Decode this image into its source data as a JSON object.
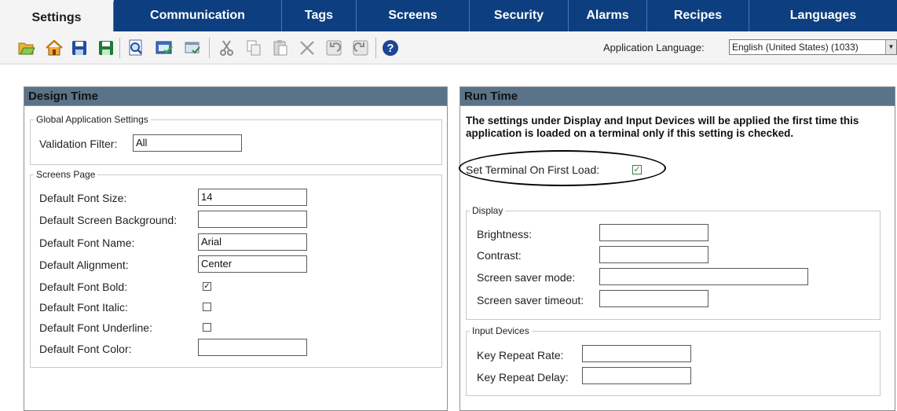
{
  "tabs": [
    {
      "label": "Settings",
      "active": true
    },
    {
      "label": "Communication",
      "active": false
    },
    {
      "label": "Tags",
      "active": false
    },
    {
      "label": "Screens",
      "active": false
    },
    {
      "label": "Security",
      "active": false
    },
    {
      "label": "Alarms",
      "active": false
    },
    {
      "label": "Recipes",
      "active": false
    },
    {
      "label": "Languages",
      "active": false
    }
  ],
  "toolbar": {
    "icons": [
      "open-icon",
      "home-icon",
      "save-icon",
      "save-as-icon",
      "find-icon",
      "validate-icon",
      "properties-icon",
      "cut-icon",
      "copy-icon",
      "paste-icon",
      "delete-icon",
      "undo-icon",
      "redo-icon",
      "help-icon"
    ],
    "language_label": "Application Language:",
    "language_value": "English (United States) (1033)"
  },
  "design_time": {
    "title": "Design Time",
    "global": {
      "legend": "Global Application Settings",
      "validation_label": "Validation Filter:",
      "validation_value": "All"
    },
    "screens": {
      "legend": "Screens Page",
      "font_size_label": "Default Font Size:",
      "font_size_value": "14",
      "background_label": "Default Screen Background:",
      "background_value": "",
      "font_name_label": "Default Font Name:",
      "font_name_value": "Arial",
      "alignment_label": "Default Alignment:",
      "alignment_value": "Center",
      "bold_label": "Default Font Bold:",
      "bold_checked": true,
      "italic_label": "Default Font Italic:",
      "italic_checked": false,
      "underline_label": "Default Font Underline:",
      "underline_checked": false,
      "color_label": "Default Font Color:",
      "color_value": ""
    }
  },
  "run_time": {
    "title": "Run Time",
    "note": "The settings under Display and Input Devices will be applied the first time this application is loaded on a terminal only if this setting is checked.",
    "set_terminal_label": "Set Terminal On First Load:",
    "set_terminal_checked": true,
    "display": {
      "legend": "Display",
      "brightness_label": "Brightness:",
      "brightness_value": "",
      "contrast_label": "Contrast:",
      "contrast_value": "",
      "saver_mode_label": "Screen saver mode:",
      "saver_mode_value": "",
      "saver_timeout_label": "Screen saver timeout:",
      "saver_timeout_value": ""
    },
    "input": {
      "legend": "Input Devices",
      "repeat_rate_label": "Key Repeat Rate:",
      "repeat_rate_value": "",
      "repeat_delay_label": "Key Repeat Delay:",
      "repeat_delay_value": ""
    }
  },
  "colors": {
    "tab_bar": "#0d3f80",
    "panel_header": "#5a7389",
    "active_tab": "#f4f4f4"
  }
}
